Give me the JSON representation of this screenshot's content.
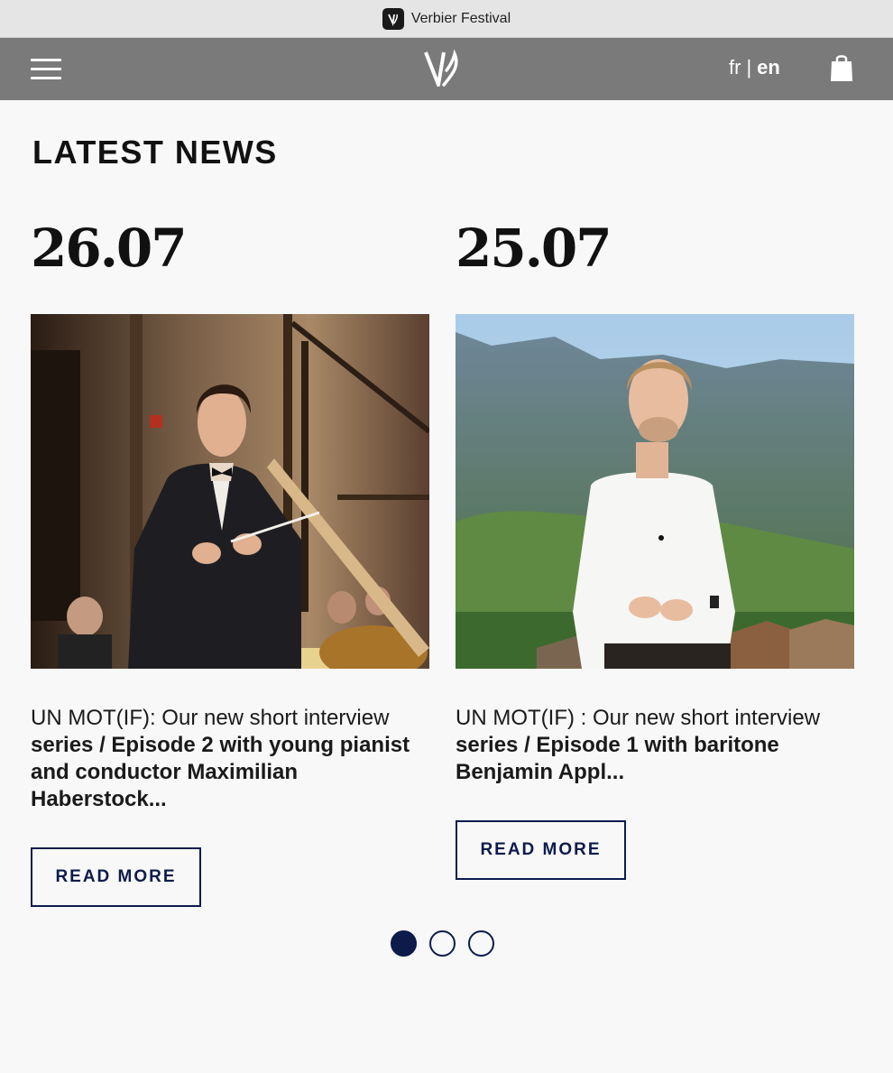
{
  "browser": {
    "tab_title": "Verbier Festival"
  },
  "nav": {
    "lang_fr": "fr",
    "lang_sep": "|",
    "lang_en": "en"
  },
  "section": {
    "title": "LATEST NEWS"
  },
  "articles": [
    {
      "date": "26.07",
      "title_head": "UN MOT(IF): Our new short interview",
      "title_rest": "series / Episode 2 with young pianist and conductor Maximilian Haberstock...",
      "button": "READ MORE"
    },
    {
      "date": "25.07",
      "title_head": "UN MOT(IF) : Our new short interview",
      "title_rest": "series / Episode 1 with baritone Benjamin Appl...",
      "button": "READ MORE"
    }
  ],
  "carousel": {
    "page_count": 3,
    "active_index": 0
  },
  "colors": {
    "accent": "#0d1b4b",
    "nav_bg": "#7a7a7a",
    "page_bg": "#f8f8f8"
  },
  "icons": {
    "menu": "hamburger-menu-icon",
    "logo": "verbier-festival-logo",
    "cart": "shopping-bag-icon"
  }
}
